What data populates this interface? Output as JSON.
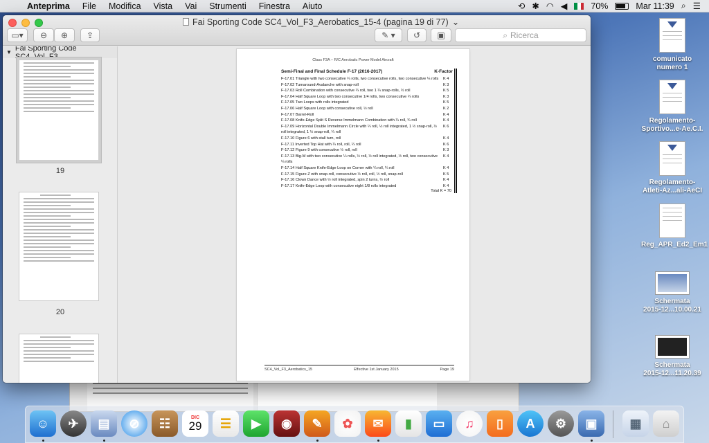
{
  "menubar": {
    "app_name": "Anteprima",
    "items": [
      "File",
      "Modifica",
      "Vista",
      "Vai",
      "Strumenti",
      "Finestra",
      "Aiuto"
    ],
    "battery": "70%",
    "clock": "Mar 11:39"
  },
  "window": {
    "title": "Fai Sporting Code SC4_Vol_F3_Aerobatics_15-4 (pagina 19 di 77)",
    "search_placeholder": "Ricerca"
  },
  "sidebar": {
    "doc_name": "Fai Sporting Code SC4_Vol_F3_...",
    "pages": [
      "19",
      "20"
    ]
  },
  "page": {
    "header": "Class F3A – R/C Aerobatic Power Model Aircraft",
    "table_title": "Semi-Final and Final Schedule F-17 (2016-2017)",
    "k_header": "K-Factor",
    "rows": [
      {
        "desc": "F-17.01 Triangle with two consecutive ¼ rolls, two consecutive rolls, two consecutive ¼ rolls",
        "k": "K 4"
      },
      {
        "desc": "F-17.02 Turnaround-Avalanche with snap-roll",
        "k": "K 3"
      },
      {
        "desc": "F-17.03 Roll Combination with consecutive ¼ roll, two 1 ¼ snap-rolls, ½ roll",
        "k": "K 5"
      },
      {
        "desc": "F-17.04 Half Square Loop with two consecutive 1/4 rolls, two consecutive ¼ rolls",
        "k": "K 3"
      },
      {
        "desc": "F-17.05 Two Loops with rolls integrated",
        "k": "K 5"
      },
      {
        "desc": "F-17.06 Half Square Loop with consecutive roll, ½ roll",
        "k": "K 2"
      },
      {
        "desc": "F-17.07 Barrel-Roll",
        "k": "K 4"
      },
      {
        "desc": "F-17.08 Knife-Edge Split S Reverse Immelmann Combination with ¼ roll, ¾ roll",
        "k": "K 4"
      },
      {
        "desc": "F-17.09 Horizontal Double Immelmann Circle with ¼ roll, ½ roll integrated, 1 ½ snap-roll, ½ roll integrated, 1 ½ snap-roll, ¼ roll",
        "k": "K 6"
      },
      {
        "desc": "F-17.10 Figure 6 with stall turn, roll",
        "k": "K 4"
      },
      {
        "desc": "F-17.11 Inverted Top Hat with ¼ roll, roll, ¼ roll",
        "k": "K 6"
      },
      {
        "desc": "F-17.12 Figure 9 with consecutive ½ roll, roll",
        "k": "K 3"
      },
      {
        "desc": "F-17.13 Big-M with two consecutive ¼ rolls, ½ roll, ½ roll integrated, ½ roll, two consecutive ¼ rolls",
        "k": "K 4"
      },
      {
        "desc": "F-17.14 Half Square Knife-Edge Loop on Corner with ¼ roll, ¼ roll",
        "k": "K 4"
      },
      {
        "desc": "F-17.15 Figure Z with snap-roll, consecutive ½ roll, roll, ½ roll, snap-roll",
        "k": "K 5"
      },
      {
        "desc": "F-17.16 Clown Dance with ½ roll integrated, spin 2 turns, ½ roll",
        "k": "K 4"
      },
      {
        "desc": "F-17.17 Knife-Edge Loop with consecutive eight 1/8 rolls integrated",
        "k": "K 4"
      }
    ],
    "total": "Total K = 70",
    "footer_left": "SC4_Vol_F3_Aerobatics_15",
    "footer_center": "Effective 1st January 2015",
    "footer_right": "Page 19"
  },
  "desktop": {
    "icons": [
      {
        "line1": "comunicato",
        "line2": "numero 1"
      },
      {
        "line1": "Regolamento-",
        "line2": "Sportivo...e-Ae.C.I."
      },
      {
        "line1": "Regolamento-",
        "line2": "Atleti-Az...ali-AeCI"
      },
      {
        "line1": "Reg_APR_Ed2_Em1",
        "line2": ""
      },
      {
        "line1": "Schermata",
        "line2": "2015-12...10.00.21"
      },
      {
        "line1": "Schermata",
        "line2": "2015-12...11.20.39"
      }
    ]
  },
  "dock": {
    "calendar_month": "DIC",
    "calendar_day": "29"
  }
}
